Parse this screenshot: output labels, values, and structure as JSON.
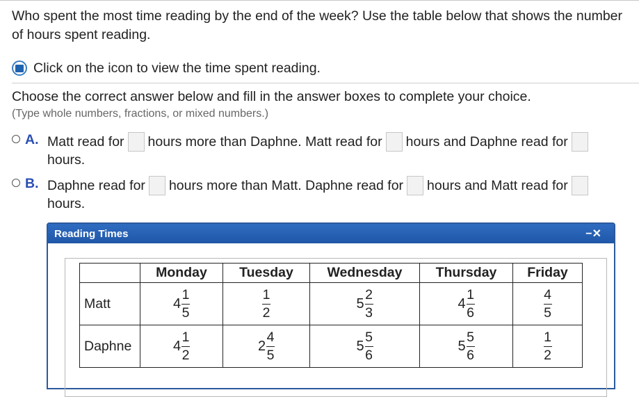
{
  "question": {
    "line1": "Who spent the most time reading by the end of the week? Use the table below that shows the number",
    "line2": "of hours spent reading."
  },
  "info": {
    "text": "Click on the icon to view the time spent reading.",
    "icon": "info-square-icon"
  },
  "instructions": "Choose the correct answer below and fill in the answer boxes to complete your choice.",
  "hint": "(Type whole numbers, fractions, or mixed numbers.)",
  "choices": [
    {
      "letter": "A.",
      "parts": [
        "Matt read for",
        "hours more than Daphne. Matt read for",
        "hours and Daphne read for"
      ],
      "end": "hours."
    },
    {
      "letter": "B.",
      "parts": [
        "Daphne read for",
        "hours more than Matt. Daphne read for",
        "hours and Matt read for"
      ],
      "end": "hours."
    }
  ],
  "dialog": {
    "title": "Reading Times",
    "close_label": "−✕"
  },
  "table": {
    "headers": [
      "",
      "Monday",
      "Tuesday",
      "Wednesday",
      "Thursday",
      "Friday"
    ],
    "rows": [
      {
        "name": "Matt",
        "values": [
          {
            "whole": "4",
            "num": "1",
            "den": "5"
          },
          {
            "whole": "",
            "num": "1",
            "den": "2"
          },
          {
            "whole": "5",
            "num": "2",
            "den": "3"
          },
          {
            "whole": "4",
            "num": "1",
            "den": "6"
          },
          {
            "whole": "",
            "num": "4",
            "den": "5"
          }
        ]
      },
      {
        "name": "Daphne",
        "values": [
          {
            "whole": "4",
            "num": "1",
            "den": "2"
          },
          {
            "whole": "2",
            "num": "4",
            "den": "5"
          },
          {
            "whole": "5",
            "num": "5",
            "den": "6"
          },
          {
            "whole": "5",
            "num": "5",
            "den": "6"
          },
          {
            "whole": "",
            "num": "1",
            "den": "2"
          }
        ]
      }
    ]
  }
}
